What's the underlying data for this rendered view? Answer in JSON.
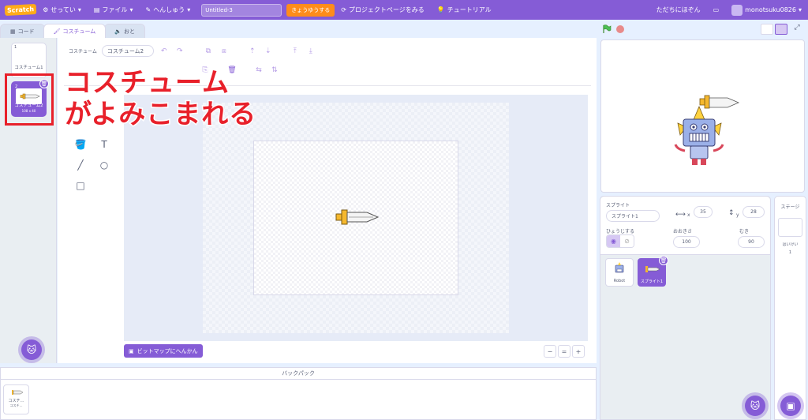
{
  "menubar": {
    "logo": "Scratch",
    "settings": "せってい",
    "file": "ファイル",
    "edit": "へんしゅう",
    "project_title": "Untitled-3",
    "share": "きょうゆうする",
    "project_page": "プロジェクトページをみる",
    "tutorials": "チュートリアル",
    "save_now": "ただちにほぞん",
    "username": "monotsuku0826"
  },
  "tabs": {
    "code": "コード",
    "costumes": "コスチューム",
    "sounds": "おと"
  },
  "costumes": [
    {
      "number": "1",
      "name": "コスチューム1",
      "size": ""
    },
    {
      "number": "2",
      "name": "コスチューム2",
      "size": "108 x 40"
    }
  ],
  "editor": {
    "costume_label": "コスチューム",
    "costume_name": "コスチューム2",
    "convert_bitmap": "ビットマップにへんかん",
    "zoom_reset": "="
  },
  "overlay": {
    "line1": "コスチューム",
    "line2": "がよみこまれる"
  },
  "backpack": {
    "title": "バックパック",
    "item_label": "コスチ…",
    "item_sub": "コスチ…"
  },
  "sprite_info": {
    "sprite_label": "スプライト",
    "sprite_name": "スプライト1",
    "x_label": "x",
    "x_value": "35",
    "y_label": "y",
    "y_value": "28",
    "show_label": "ひょうじする",
    "size_label": "おおきさ",
    "size_value": "100",
    "direction_label": "むき",
    "direction_value": "90"
  },
  "sprites": [
    {
      "name": "Robot"
    },
    {
      "name": "スプライト1"
    }
  ],
  "stage_pane": {
    "title": "ステージ",
    "backdrops_label": "はいけい",
    "backdrops_count": "1"
  },
  "colors": {
    "accent": "#855cd6",
    "share": "#ff8c1a",
    "overlay_red": "#e8202a"
  }
}
